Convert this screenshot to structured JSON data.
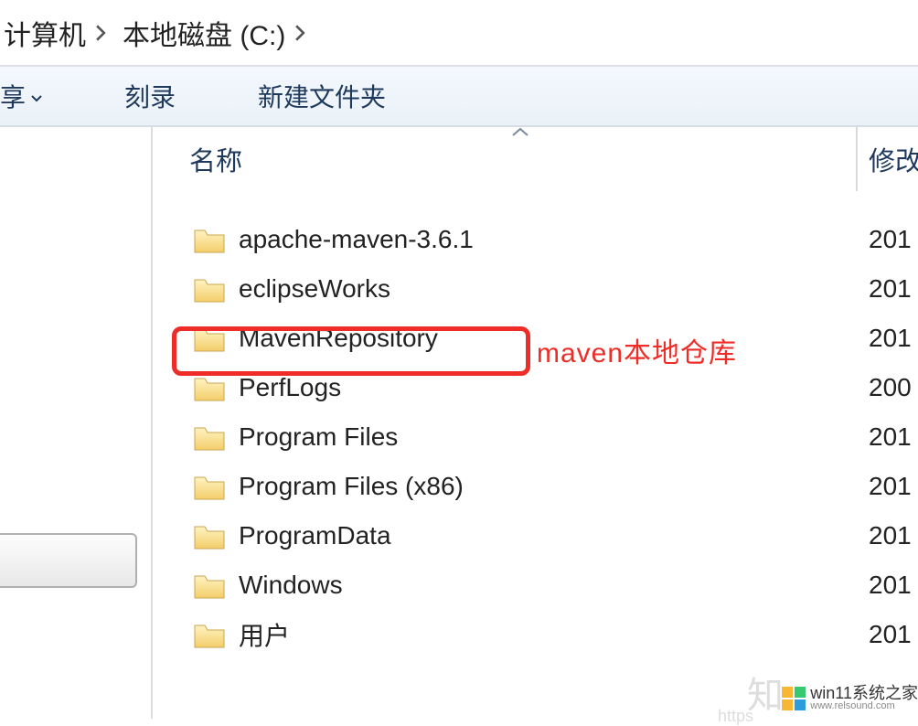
{
  "breadcrumb": {
    "items": [
      "计算机",
      "本地磁盘 (C:)"
    ]
  },
  "toolbar": {
    "share_label": "享",
    "burn_label": "刻录",
    "newfolder_label": "新建文件夹"
  },
  "columns": {
    "name": "名称",
    "modified": "修改"
  },
  "files": [
    {
      "name": "apache-maven-3.6.1",
      "modified": "201"
    },
    {
      "name": "eclipseWorks",
      "modified": "201"
    },
    {
      "name": "MavenRepository",
      "modified": "201"
    },
    {
      "name": "PerfLogs",
      "modified": "200"
    },
    {
      "name": "Program Files",
      "modified": "201"
    },
    {
      "name": "Program Files (x86)",
      "modified": "201"
    },
    {
      "name": "ProgramData",
      "modified": "201"
    },
    {
      "name": "Windows",
      "modified": "201"
    },
    {
      "name": "用户",
      "modified": "201"
    }
  ],
  "annotation": "maven本地仓库",
  "watermarks": {
    "zhihu": "知",
    "url": "https",
    "site": "win11系统之家",
    "domain": "www.relsound.com"
  }
}
